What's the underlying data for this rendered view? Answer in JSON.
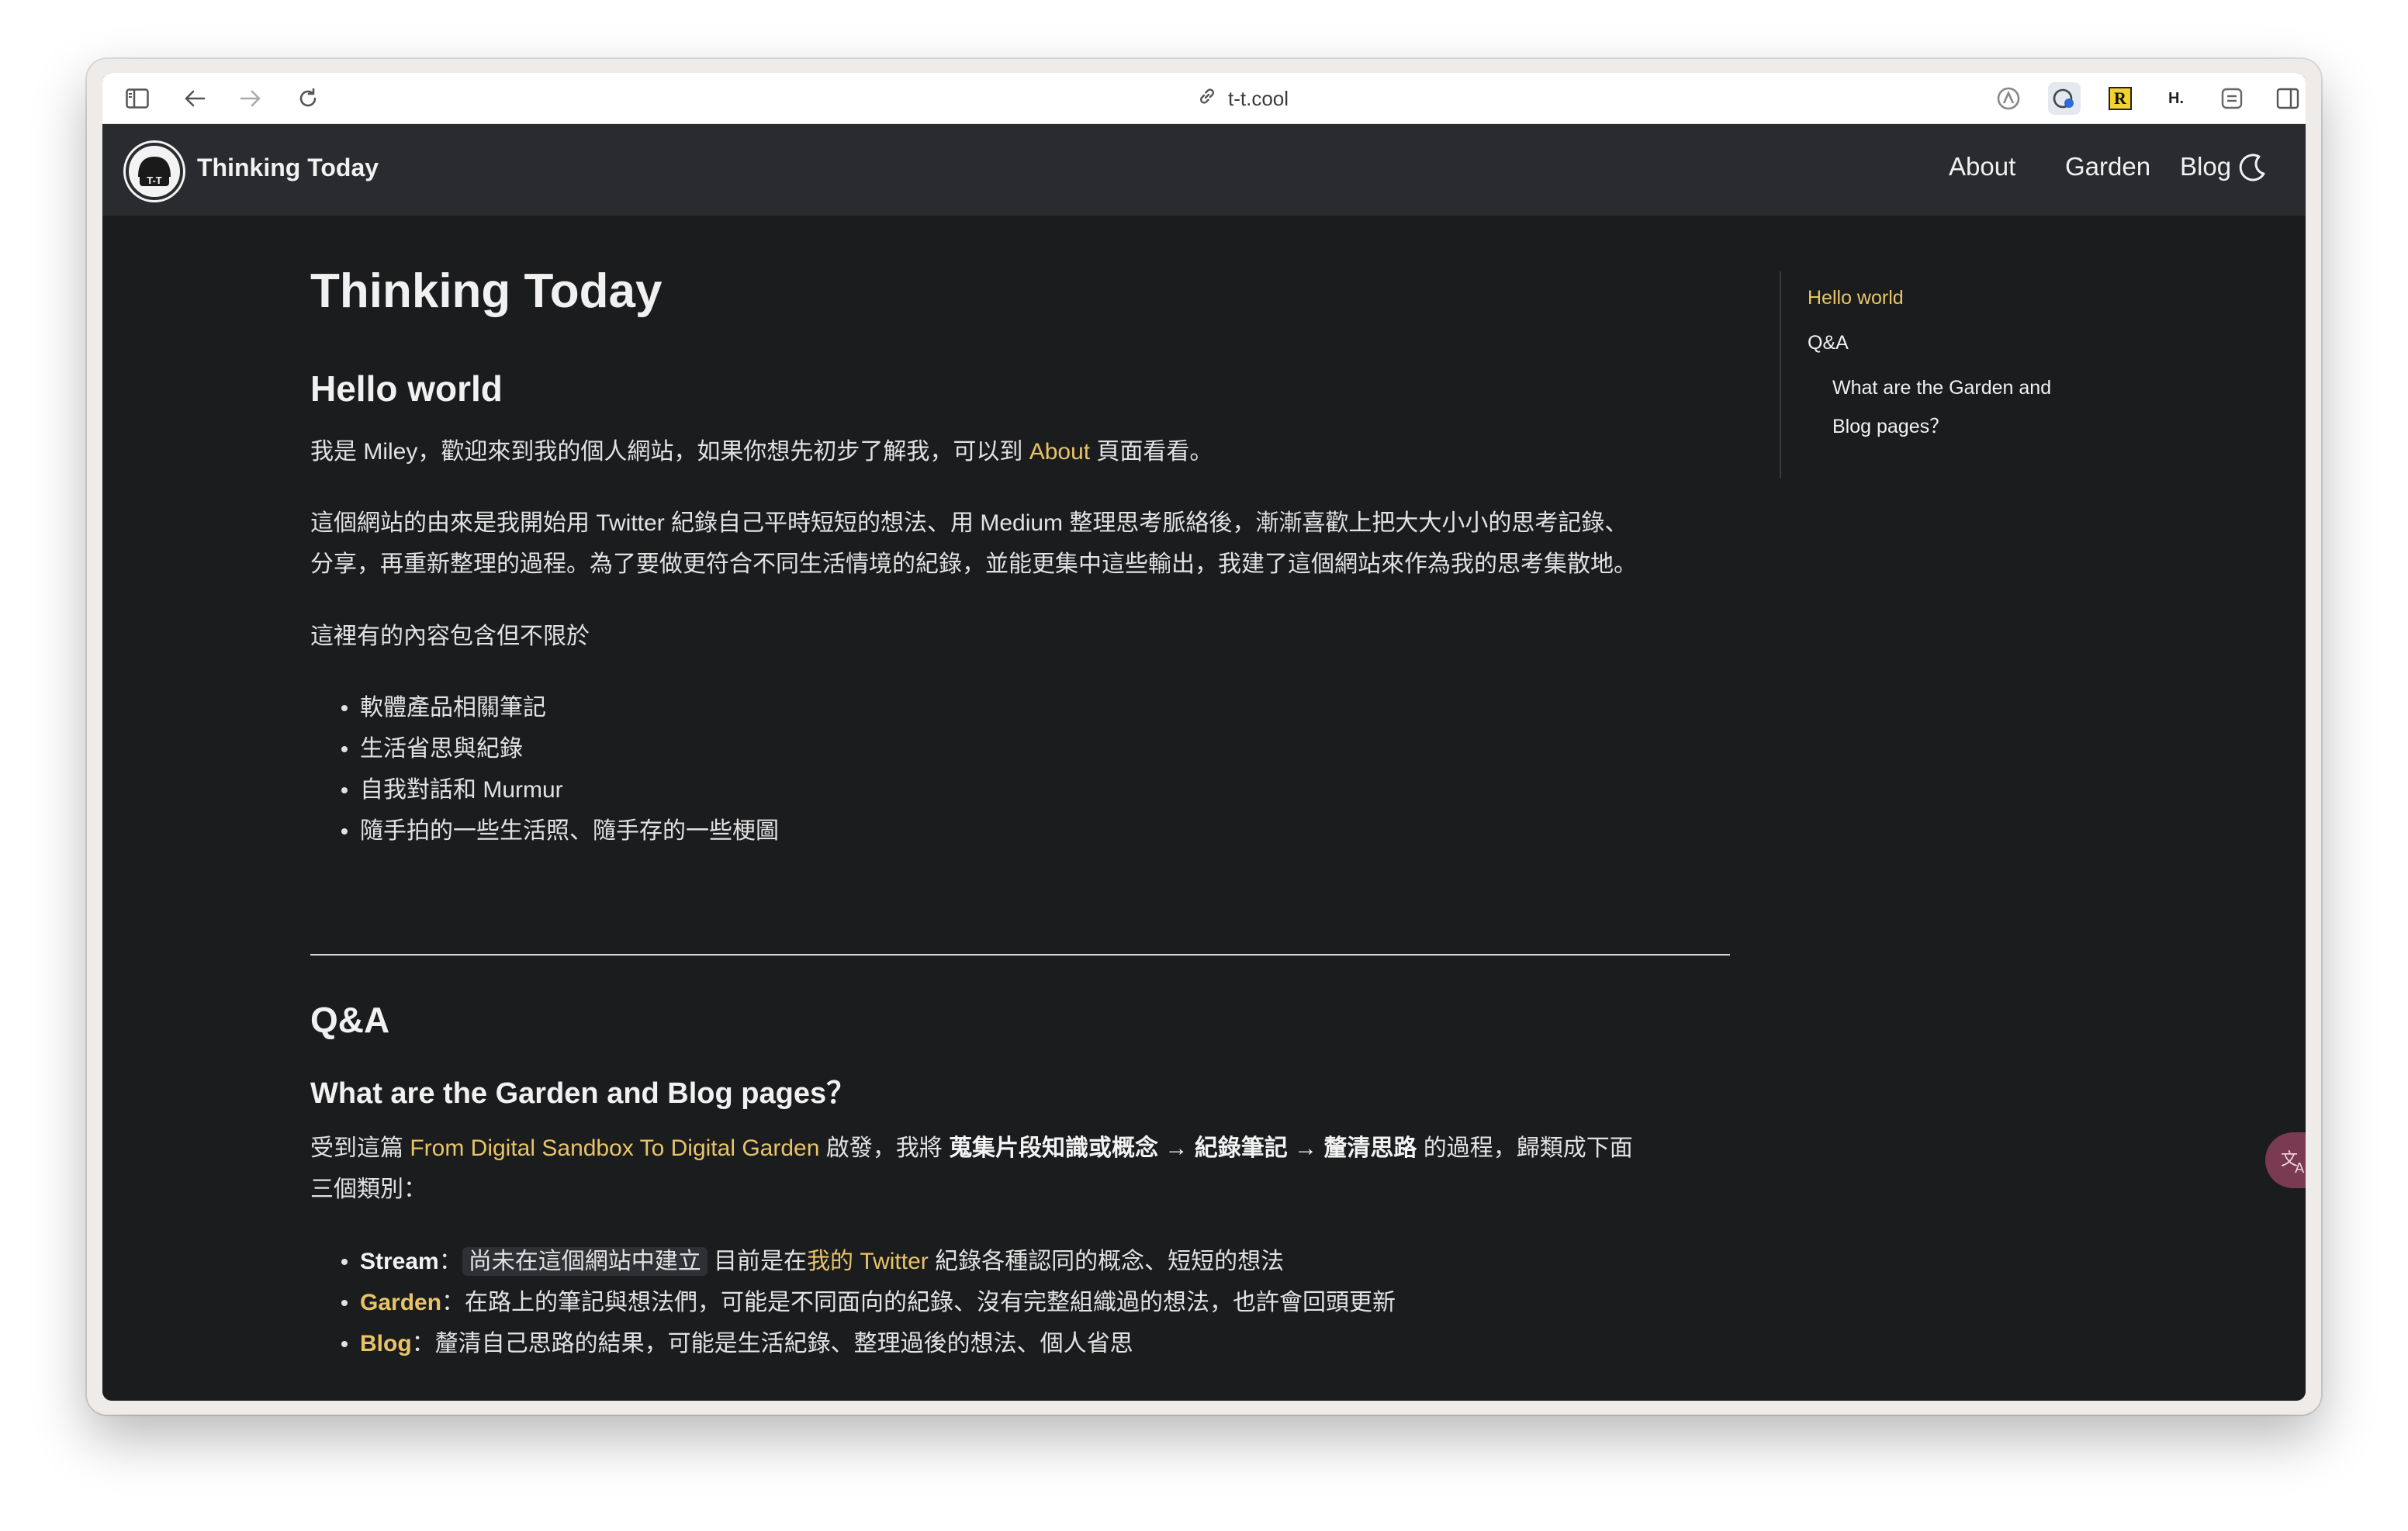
{
  "browser": {
    "url": "t-t.cool",
    "buttons": {
      "sidebar": "sidebar-toggle-icon",
      "back": "back-arrow-icon",
      "forward": "forward-arrow-icon",
      "reload": "reload-icon"
    },
    "extensions": [
      "adguard-icon",
      "bitwarden-icon",
      "readwise-icon",
      "hypothesis-icon",
      "extension-icon",
      "split-view-icon"
    ],
    "extension_labels": {
      "readwise": "R",
      "hypothesis": "H."
    }
  },
  "header": {
    "title": "Thinking Today",
    "nav": [
      "About",
      "Garden",
      "Blog"
    ],
    "theme_toggle": "moon-icon"
  },
  "article": {
    "title": "Thinking Today",
    "hello_heading": "Hello world",
    "intro": {
      "before": "我是 Miley，歡迎來到我的個人網站，如果你想先初步了解我，可以到 ",
      "link": "About",
      "after": " 頁面看看。"
    },
    "para2_line1": "這個網站的由來是我開始用 Twitter 紀錄自己平時短短的想法、用 Medium 整理思考脈絡後，漸漸喜歡上把大大小小的思考記錄、",
    "para2_line2": "分享，再重新整理的過程。為了要做更符合不同生活情境的紀錄，並能更集中這些輸出，我建了這個網站來作為我的思考集散地。",
    "contents_intro": "這裡有的內容包含但不限於",
    "contents": [
      "軟體產品相關筆記",
      "生活省思與紀錄",
      "自我對話和 Murmur",
      "隨手拍的一些生活照、隨手存的一些梗圖"
    ],
    "qa_heading": "Q&A",
    "qa_sub": "What are the Garden and Blog pages？",
    "qa_para": {
      "before": "受到這篇 ",
      "link": "From Digital Sandbox To Digital Garden",
      "mid": " 啟發，我將 ",
      "bold": "蒐集片段知識或概念 → 紀錄筆記 → 釐清思路",
      "after": " 的過程，歸類成下面",
      "line2": "三個類別："
    },
    "categories": [
      {
        "name": "Stream",
        "sep": "：",
        "code": "尚未在這個網站中建立",
        "mid": " 目前是在",
        "link": "我的 Twitter",
        "desc": " 紀錄各種認同的概念、短短的想法"
      },
      {
        "name": "Garden",
        "desc": "：在路上的筆記與想法們，可能是不同面向的紀錄、沒有完整組織過的想法，也許會回頭更新"
      },
      {
        "name": "Blog",
        "desc": "：釐清自己思路的結果，可能是生活紀錄、整理過後的想法、個人省思"
      }
    ]
  },
  "toc": {
    "items": [
      "Hello world",
      "Q&A",
      "What are the Garden and",
      "Blog pages？"
    ]
  },
  "colors": {
    "accent": "#e8c467",
    "background": "#1b1c1e",
    "header_bg": "#2a2b2e"
  }
}
